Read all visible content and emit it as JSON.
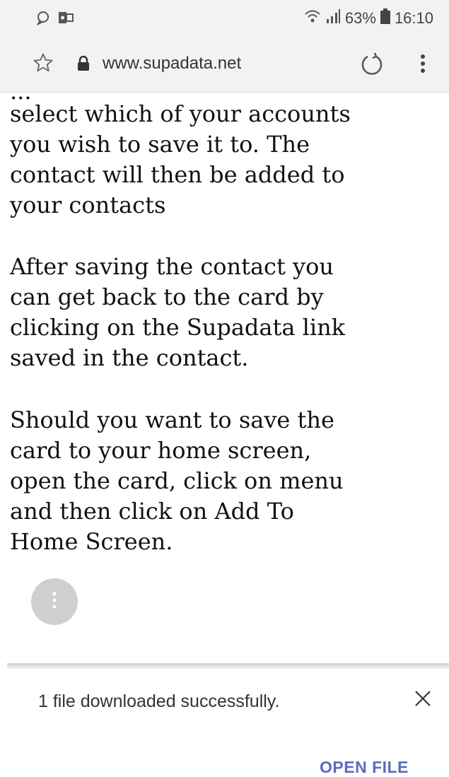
{
  "status_bar": {
    "icons_left": [
      "chat-bubble-icon",
      "outlook-icon"
    ],
    "icons_right": [
      "wifi-icon",
      "signal-icon"
    ],
    "battery_percent": "63%",
    "time": "16:10"
  },
  "address_bar": {
    "url": "www.supadata.net",
    "icons": [
      "star-icon",
      "lock-icon",
      "reload-icon",
      "more-vert-icon"
    ]
  },
  "content": {
    "cut_line": "...",
    "paragraph_1": "select which of your accounts\nyou wish to save it to. The\ncontact will then be added to\nyour contacts",
    "paragraph_2": "After saving the contact you\ncan get back to the card by\nclicking on the Supadata link\nsaved in the contact.",
    "paragraph_3": "Should you want to save the\ncard to your home screen,\nopen the card, click on menu\nand then click on Add To\nHome Screen."
  },
  "floating_button": {
    "icon": "more-vert-icon"
  },
  "download_bar": {
    "message": "1 file downloaded successfully.",
    "action_label": "OPEN FILE",
    "close_icon": "close-icon"
  },
  "colors": {
    "chrome_background": "#f2f2f2",
    "action_color": "#5c6bc0",
    "fab_background": "#cfcfcf"
  }
}
